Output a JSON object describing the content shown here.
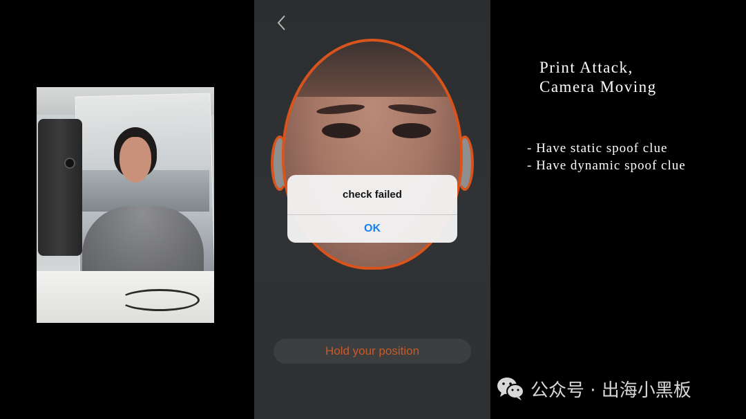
{
  "dialog": {
    "title": "check failed",
    "ok_label": "OK"
  },
  "status_pill": {
    "text": "Hold your position"
  },
  "annotation": {
    "title": "Print  Attack,\nCamera  Moving",
    "items": [
      "-  Have  static  spoof  clue",
      "-  Have  dynamic  spoof  clue"
    ]
  },
  "watermark": {
    "text": "公众号 · 出海小黑板",
    "icon": "wechat-icon"
  },
  "colors": {
    "accent_orange": "#d9531c",
    "ok_blue": "#1a7ff0",
    "background": "#000000"
  }
}
